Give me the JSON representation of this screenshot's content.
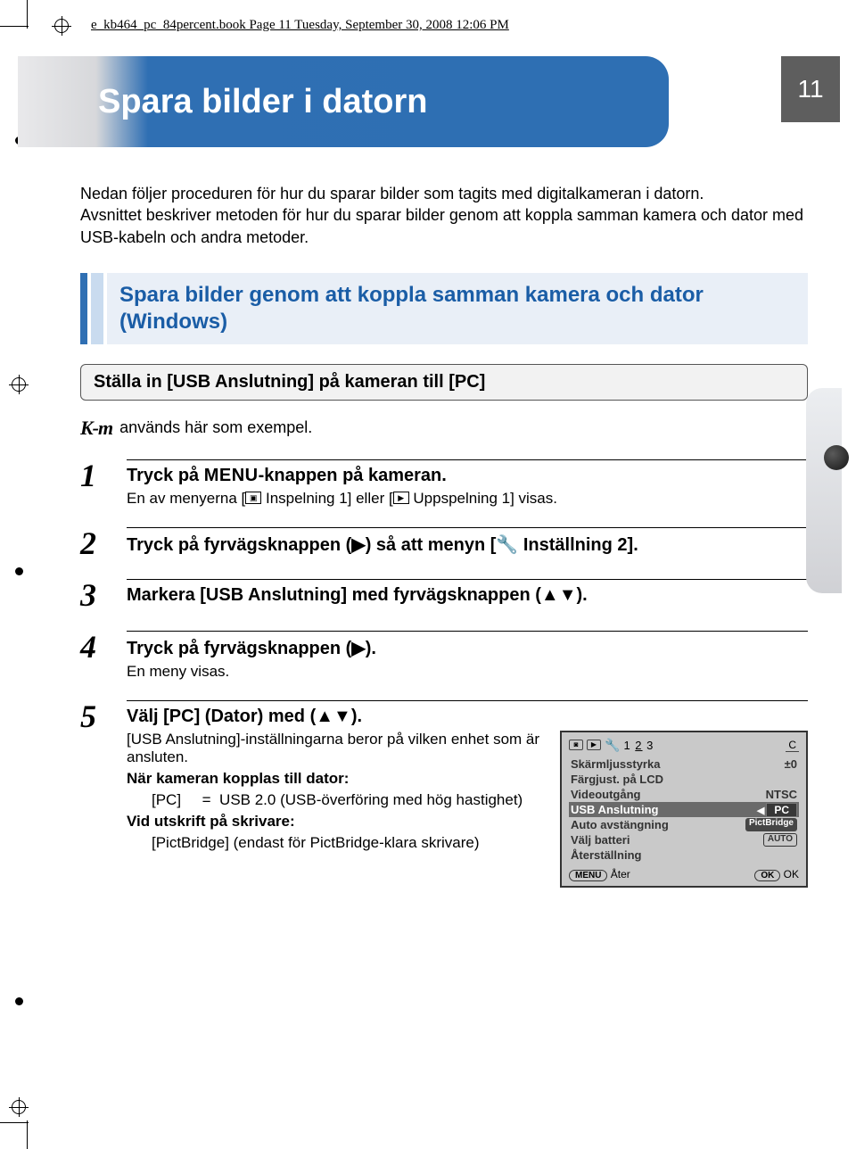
{
  "meta_header": "e_kb464_pc_84percent.book  Page 11  Tuesday, September 30, 2008  12:06 PM",
  "page_number": "11",
  "title": "Spara bilder i datorn",
  "intro": "Nedan följer proceduren för hur du sparar bilder som tagits med digitalkameran i datorn.\nAvsnittet beskriver metoden för hur du sparar bilder genom att koppla samman kamera och dator med USB-kabeln och andra metoder.",
  "section_heading": "Spara bilder genom att koppla samman kamera och dator (Windows)",
  "sub_heading": "Ställa in [USB Anslutning] på kameran till [PC]",
  "example_line": " används här som exempel.",
  "km_logo": "K-m",
  "steps": {
    "s1": {
      "num": "1",
      "title_before": "Tryck på ",
      "title_menu": "MENU",
      "title_after": "-knappen på kameran.",
      "desc_before": "En av menyerna [",
      "desc_rec": " Inspelning 1] eller [",
      "desc_play": " Uppspelning 1] visas."
    },
    "s2": {
      "num": "2",
      "title": "Tryck på fyrvägsknappen (▶) så att menyn [🔧 Inställning 2]."
    },
    "s3": {
      "num": "3",
      "title": "Markera [USB Anslutning] med fyrvägsknappen (▲▼)."
    },
    "s4": {
      "num": "4",
      "title": "Tryck på fyrvägsknappen (▶).",
      "desc": "En meny visas."
    },
    "s5": {
      "num": "5",
      "title": "Välj [PC] (Dator) med (▲▼).",
      "p1": "[USB Anslutning]-inställningarna beror på vilken enhet som är ansluten.",
      "p2_label": "När kameran kopplas till dator:",
      "p2_val": "[PC]     =  USB 2.0 (USB-överföring med hög hastighet)",
      "p3_label": "Vid utskrift på skrivare:",
      "p3_val": "[PictBridge] (endast för PictBridge-klara skrivare)"
    }
  },
  "lcd": {
    "tabs": {
      "n1": "1",
      "n2": "2",
      "n3": "3",
      "c": "C"
    },
    "rows": {
      "brightness": {
        "label": "Skärmljusstyrka",
        "val": "±0"
      },
      "colour": {
        "label": "Färgjust. på LCD"
      },
      "video": {
        "label": "Videoutgång",
        "val": "NTSC"
      },
      "usb": {
        "label": "USB Anslutning",
        "val": "PC",
        "opt": "PictBridge"
      },
      "auto": {
        "label": "Auto avstängning",
        "val": "PictBridge"
      },
      "battery": {
        "label": "Välj batteri",
        "val": "AUTO"
      },
      "reset": {
        "label": "Återställning"
      }
    },
    "bottom": {
      "menu": "MENU",
      "back": "Åter",
      "ok_btn": "OK",
      "ok": "OK"
    }
  }
}
